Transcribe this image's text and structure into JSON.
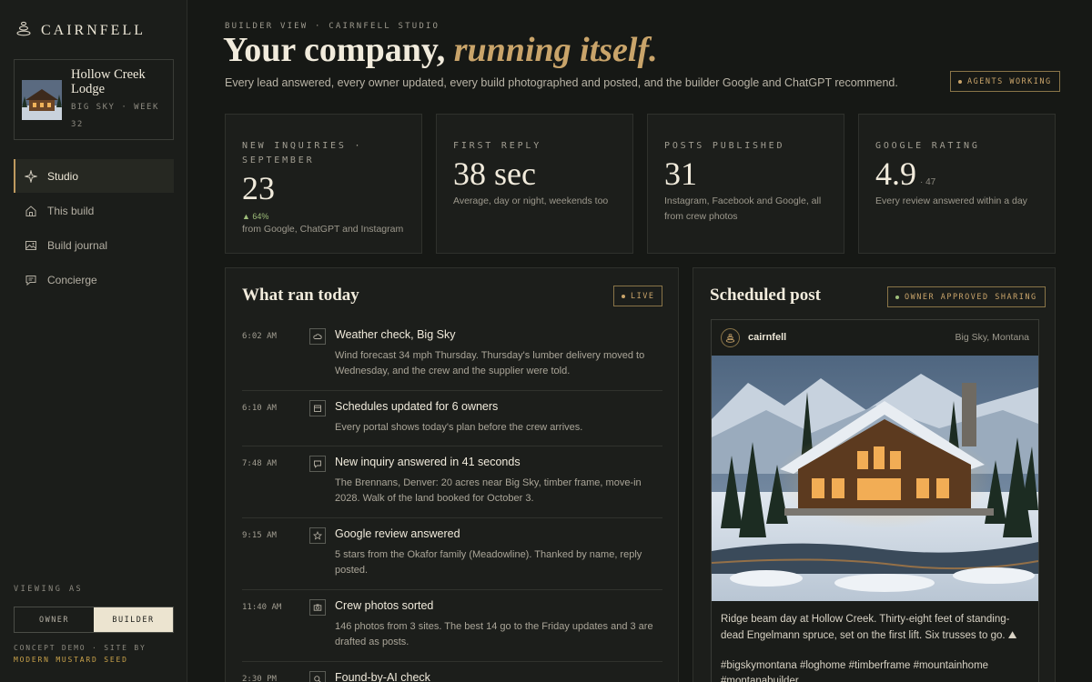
{
  "sidebar": {
    "brand": "CAIRNFELL",
    "project": {
      "name": "Hollow Creek Lodge",
      "sub": "BIG SKY · WEEK 32"
    },
    "nav": [
      {
        "label": "Studio",
        "icon": "sparkle-icon",
        "active": true
      },
      {
        "label": "This build",
        "icon": "home-icon",
        "active": false
      },
      {
        "label": "Build journal",
        "icon": "image-icon",
        "active": false
      },
      {
        "label": "Concierge",
        "icon": "chat-icon",
        "active": false
      }
    ],
    "viewing_as_label": "VIEWING AS",
    "toggle": {
      "owner": "OWNER",
      "builder": "BUILDER",
      "selected": "BUILDER"
    },
    "credit_line1": "CONCEPT DEMO · SITE BY",
    "credit_line2": "MODERN MUSTARD SEED"
  },
  "header": {
    "kicker": "BUILDER VIEW · CAIRNFELL STUDIO",
    "headline_plain": "Your company,",
    "headline_italic": "running itself.",
    "lede": "Every lead answered, every owner updated, every build photographed and posted, and the builder Google and ChatGPT recommend.",
    "status_badge": "AGENTS WORKING"
  },
  "stats": [
    {
      "label": "NEW INQUIRIES · SEPTEMBER",
      "value": "23",
      "delta": "▲ 64%",
      "note": "from Google, ChatGPT and Instagram"
    },
    {
      "label": "FIRST REPLY",
      "value": "38 sec",
      "note": "Average, day or night, weekends too"
    },
    {
      "label": "POSTS PUBLISHED",
      "value": "31",
      "note": "Instagram, Facebook and Google, all from crew photos"
    },
    {
      "label": "GOOGLE RATING",
      "value": "4.9",
      "value_suffix": "· 47",
      "note": "Every review answered within a day"
    }
  ],
  "activity": {
    "title": "What ran today",
    "badge": "LIVE",
    "events": [
      {
        "time": "6:02 AM",
        "icon": "cloud-icon",
        "title": "Weather check, Big Sky",
        "desc": "Wind forecast 34 mph Thursday. Thursday's lumber delivery moved to Wednesday, and the crew and the supplier were told."
      },
      {
        "time": "6:10 AM",
        "icon": "calendar-icon",
        "title": "Schedules updated for 6 owners",
        "desc": "Every portal shows today's plan before the crew arrives."
      },
      {
        "time": "7:48 AM",
        "icon": "chat-icon",
        "title": "New inquiry answered in 41 seconds",
        "desc": "The Brennans, Denver: 20 acres near Big Sky, timber frame, move-in 2028. Walk of the land booked for October 3."
      },
      {
        "time": "9:15 AM",
        "icon": "star-icon",
        "title": "Google review answered",
        "desc": "5 stars from the Okafor family (Meadowline). Thanked by name, reply posted."
      },
      {
        "time": "11:40 AM",
        "icon": "camera-icon",
        "title": "Crew photos sorted",
        "desc": "146 photos from 3 sites. The best 14 go to the Friday updates and 3 are drafted as posts."
      },
      {
        "time": "2:30 PM",
        "icon": "search-icon",
        "title": "Found-by-AI check",
        "desc": ""
      }
    ]
  },
  "scheduled": {
    "title": "Scheduled post",
    "badge": "OWNER APPROVED SHARING",
    "post": {
      "user": "cairnfell",
      "location": "Big Sky, Montana",
      "caption": "Ridge beam day at Hollow Creek. Thirty-eight feet of standing-dead Engelmann spruce, set on the first lift. Six trusses to go. ⛰",
      "tags": "#bigskymontana #loghome #timberframe #mountainhome #montanabuilder"
    }
  },
  "colors": {
    "accent": "#c9a46a",
    "live_green": "#9fbf7a",
    "background": "#161815",
    "panel": "#1c1e1b"
  }
}
